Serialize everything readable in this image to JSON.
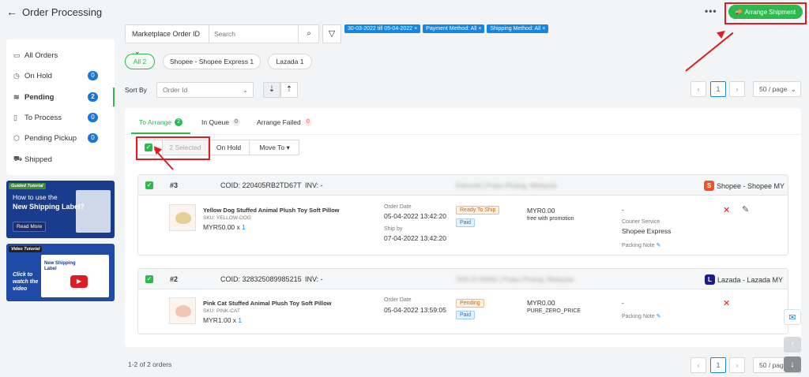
{
  "header": {
    "back": "←",
    "title": "Order Processing",
    "more": "•••",
    "arrange_button": "Arrange Shipment",
    "truck_icon": "🚚"
  },
  "sidebar": {
    "items": [
      {
        "label": "All Orders",
        "icon": "▭",
        "count": null
      },
      {
        "label": "On Hold",
        "icon": "◷",
        "count": "0"
      },
      {
        "label": "Pending",
        "icon": "≋",
        "count": "2"
      },
      {
        "label": "To Process",
        "icon": "▯",
        "count": "0"
      },
      {
        "label": "Pending Pickup",
        "icon": "⬡",
        "count": "0"
      },
      {
        "label": "Shipped",
        "icon": "⛟",
        "count": null
      }
    ]
  },
  "promo1": {
    "tag": "Guided Tutorial",
    "line1": "How to use the",
    "line2": "New Shipping Label?",
    "read_more": "Read More"
  },
  "promo2": {
    "tag": "Video Tutorial",
    "line1": "Click to",
    "line2": "watch the",
    "line3": "video",
    "screen_title": "New Shipping Label"
  },
  "search": {
    "type_label": "Marketplace Order ID",
    "placeholder": "Search"
  },
  "chips": [
    "30-03-2022 till 05-04-2022",
    "Payment Method: All",
    "Shipping Method: All"
  ],
  "store_filters": [
    "All 2",
    "Shopee - Shopee Express 1",
    "Lazada 1"
  ],
  "sort": {
    "label": "Sort By",
    "value": "Order Id"
  },
  "pagination": {
    "current": "1",
    "page_size": "50 / page"
  },
  "tabs": [
    {
      "label": "To Arrange",
      "count": "2"
    },
    {
      "label": "In Queue",
      "count": "0"
    },
    {
      "label": "Arrange Failed",
      "count": "0"
    }
  ],
  "bulk": {
    "selected": "2 Selected",
    "on_hold": "On Hold",
    "move_to": "Move To"
  },
  "orders": [
    {
      "num": "#3",
      "coid": "COID: 220405RB2TD67T",
      "inv": "INV: -",
      "customer": "Edmund | Pulau Pinang, Malaysia",
      "store": "Shopee - Shopee MY",
      "store_icon": "S",
      "product": "Yellow Dog Stuffed Animal Plush Toy Soft Pillow",
      "sku": "SKU: YELLOW-DOG",
      "price": "MYR50.00 x",
      "qty": "1",
      "order_date_label": "Order Date",
      "order_date": "05-04-2022 13:42:20",
      "ship_by_label": "Ship by",
      "ship_by": "07-04-2022 13:42:20",
      "status": "Ready To Ship",
      "payment": "Paid",
      "amount": "MYR0.00",
      "amount_note": "free with promotion",
      "courier_dash": "-",
      "courier_label": "Courier Service",
      "courier": "Shopee Express",
      "packing_note": "Packing Note"
    },
    {
      "num": "#2",
      "coid": "COID: 328325089985215",
      "inv": "INV: -",
      "customer": "TAN ZI HANG | Pulau Pinang, Malaysia",
      "store": "Lazada - Lazada MY",
      "store_icon": "L",
      "product": "Pink Cat Stuffed Animal Plush Toy Soft Pillow",
      "sku": "SKU: PINK-CAT",
      "price": "MYR1.00 x",
      "qty": "1",
      "order_date_label": "Order Date",
      "order_date": "05-04-2022 13:59:05",
      "status": "Pending",
      "payment": "Paid",
      "amount": "MYR0.00",
      "amount_note": "PURE_ZERO_PRICE",
      "courier_dash": "-",
      "packing_note": "Packing Note"
    }
  ],
  "footer": {
    "count": "1-2 of 2 orders"
  }
}
